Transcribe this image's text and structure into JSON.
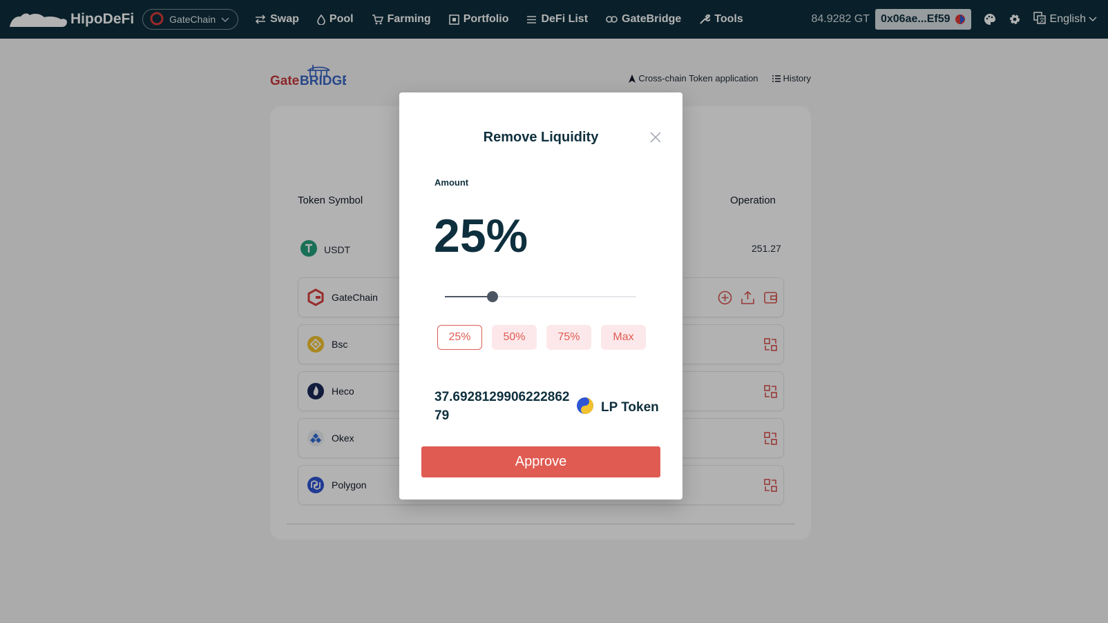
{
  "app": {
    "name": "HipoDeFi"
  },
  "chain_selector": {
    "value": "GateChain"
  },
  "nav": {
    "items": [
      {
        "label": "Swap",
        "icon": "swap-icon"
      },
      {
        "label": "Pool",
        "icon": "pool-icon"
      },
      {
        "label": "Farming",
        "icon": "cart-icon"
      },
      {
        "label": "Portfolio",
        "icon": "portfolio-icon"
      },
      {
        "label": "DeFi List",
        "icon": "list-icon"
      },
      {
        "label": "GateBridge",
        "icon": "link-icon"
      },
      {
        "label": "Tools",
        "icon": "wrench-icon"
      }
    ]
  },
  "account": {
    "balance": "84.9282 GT",
    "address": "0x06ae...Ef59"
  },
  "language": {
    "value": "English"
  },
  "bridge": {
    "logo_gate": "Gate",
    "logo_bridge": "BRIDGE",
    "links": {
      "apply": "Cross-chain Token application",
      "history": "History"
    },
    "columns": {
      "symbol": "Token Symbol",
      "operation": "Operation"
    },
    "token": {
      "symbol": "USDT",
      "amount": "251.27"
    },
    "chains": [
      {
        "name": "GateChain",
        "icon": "gatechain-icon"
      },
      {
        "name": "Bsc",
        "icon": "bsc-icon"
      },
      {
        "name": "Heco",
        "icon": "heco-icon"
      },
      {
        "name": "Okex",
        "icon": "okex-icon"
      },
      {
        "name": "Polygon",
        "icon": "polygon-icon"
      }
    ]
  },
  "modal": {
    "title": "Remove Liquidity",
    "amount_label": "Amount",
    "percent_display": "25%",
    "slider_fraction": 0.25,
    "buttons": [
      "25%",
      "50%",
      "75%",
      "Max"
    ],
    "active_button": "25%",
    "lp_amount": "37.692812990622286279",
    "lp_label": "LP Token",
    "approve_label": "Approve"
  },
  "colors": {
    "nav_bg": "#0e2f3d",
    "accent": "#e05b52",
    "accent_light": "#fce8ea",
    "text_dark": "#0e2f3d"
  }
}
